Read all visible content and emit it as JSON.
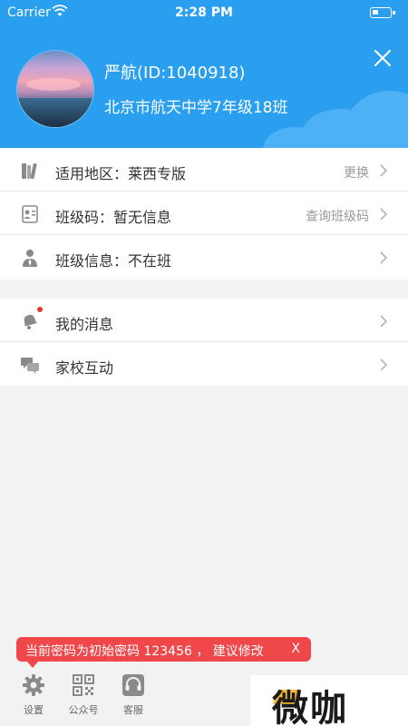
{
  "status_bar": {
    "carrier": "Carrier",
    "time": "2:28 PM"
  },
  "profile": {
    "name": "严航(ID:1040918)",
    "school": "北京市航天中学7年级18班"
  },
  "group1": [
    {
      "label": "适用地区：莱西专版",
      "right": "更换",
      "icon": "books-icon"
    },
    {
      "label": "班级码：暂无信息",
      "right": "查询班级码",
      "icon": "class-code-icon"
    },
    {
      "label": "班级信息：不在班",
      "right": "",
      "icon": "person-icon"
    }
  ],
  "group2": [
    {
      "label": "我的消息",
      "icon": "bell-icon",
      "has_badge": true
    },
    {
      "label": "家校互动",
      "icon": "chat-icon"
    }
  ],
  "toast": {
    "text": "当前密码为初始密码 123456 ， 建议修改",
    "close": "X"
  },
  "bottom_tabs": [
    {
      "label": "设置",
      "icon": "gear-icon"
    },
    {
      "label": "公众号",
      "icon": "qr-code-icon"
    },
    {
      "label": "客服",
      "icon": "headset-icon"
    }
  ],
  "watermark": {
    "text": "微咖"
  },
  "colors": {
    "header": "#2a9ff0",
    "toast": "#f0484a",
    "badge": "#e8382d"
  }
}
